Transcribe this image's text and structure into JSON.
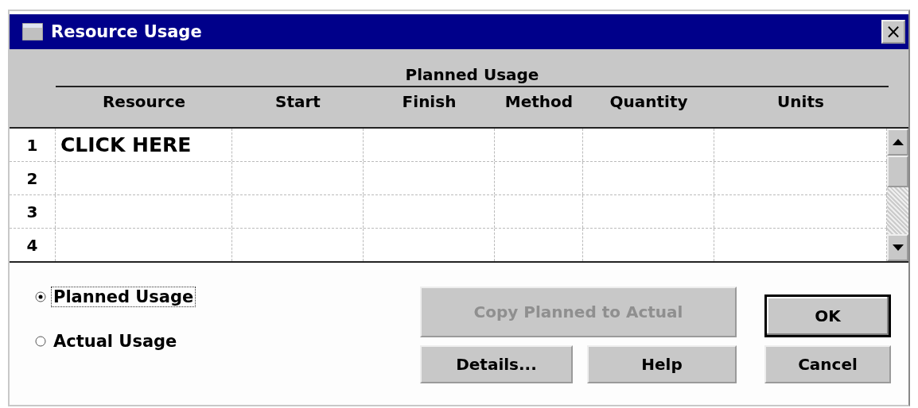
{
  "window": {
    "title": "Resource Usage",
    "close": "×"
  },
  "table": {
    "group_header": "Planned Usage",
    "columns": [
      "Resource",
      "Start",
      "Finish",
      "Method",
      "Quantity",
      "Units"
    ],
    "rows": [
      {
        "number": "1",
        "resource": "CLICK HERE"
      },
      {
        "number": "2"
      },
      {
        "number": "3"
      },
      {
        "number": "4"
      }
    ]
  },
  "usage_options": [
    {
      "label": "Planned Usage",
      "selected": true
    },
    {
      "label": "Actual Usage",
      "selected": false
    }
  ],
  "buttons": [
    {
      "label": "Copy Planned to Actual",
      "disabled": true,
      "default": false
    },
    {
      "label": "OK",
      "disabled": false,
      "default": true
    },
    {
      "label": "Details...",
      "disabled": false,
      "default": false
    },
    {
      "label": "Help",
      "disabled": false,
      "default": false
    },
    {
      "label": "Cancel",
      "disabled": false,
      "default": false
    }
  ]
}
